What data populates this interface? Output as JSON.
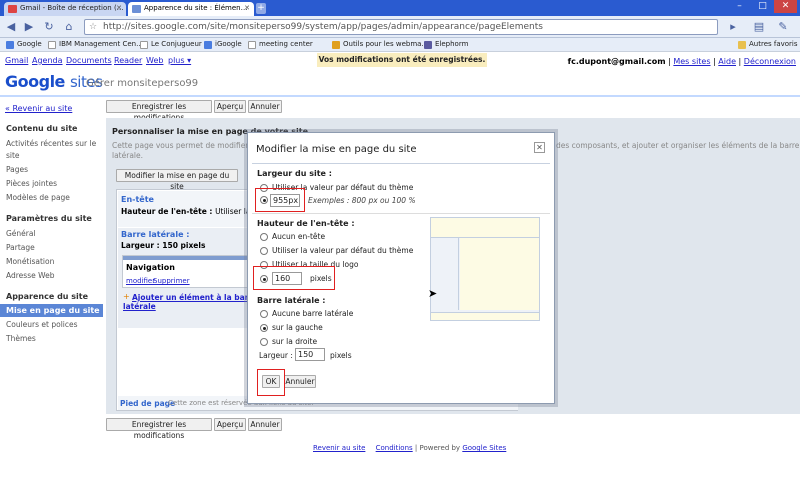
{
  "browser": {
    "tabs": [
      {
        "label": "Gmail - Boîte de réception (…",
        "favicon": "gmail-icon"
      },
      {
        "label": "Apparence du site : Élémen…",
        "favicon": "sites-icon"
      }
    ],
    "url": "http://sites.google.com/site/monsiteperso99/system/app/pages/admin/appearance/pageElements",
    "bookmarks": [
      "Google",
      "IBM Management Cen…",
      "Le Conjugueur",
      "iGoogle",
      "meeting center",
      "Outils pour les webma…",
      "Elephorm"
    ],
    "other_bookmarks": "Autres favoris"
  },
  "gbar": {
    "links": [
      "Gmail",
      "Agenda",
      "Documents",
      "Reader",
      "Web",
      "plus ▾"
    ],
    "saved_message": "Vos modifications ont été enregistrées.",
    "user_email": "fc.dupont@gmail.com",
    "user_links": [
      "Mes sites",
      "Aide",
      "Déconnexion"
    ]
  },
  "header": {
    "logo_google": "Google",
    "logo_sites": "sites",
    "manage_label": "Gérer monsiteperso99"
  },
  "toolbar": {
    "save_label": "Enregistrer les modifications",
    "preview_label": "Aperçu",
    "cancel_label": "Annuler"
  },
  "sidebar": {
    "back_link": "« Revenir au site",
    "sections": [
      {
        "title": "Contenu du site",
        "items": [
          "Activités récentes sur le",
          "site",
          "Pages",
          "Pièces jointes",
          "Modèles de page"
        ]
      },
      {
        "title": "Paramètres du site",
        "items": [
          "Général",
          "Partage",
          "Monétisation",
          "Adresse Web"
        ]
      },
      {
        "title": "Apparence du site",
        "items": [
          "Mise en page du site",
          "Couleurs et polices",
          "Thèmes"
        ]
      }
    ],
    "selected": "Mise en page du site"
  },
  "panel": {
    "title": "Personnaliser la mise en page de votre site",
    "desc_line1": "Cette page vous permet de modifier la",
    "desc_line1_right": "des composants, et ajouter et organiser les éléments de la barre",
    "desc_line2": "latérale.",
    "modify_btn": "Modifier la mise en page du site",
    "header_section": "En-tête",
    "header_height_label": "Hauteur de l'en-tête :",
    "header_height_value": "Utiliser la",
    "sidebar_section": "Barre latérale :",
    "sidebar_width": "Largeur : 150 pixels",
    "nav_title": "Navigation",
    "nav_modify": "modifier",
    "nav_delete": "Supprimer",
    "add_element_1": "Ajouter un élément à la barre",
    "add_element_2": "latérale",
    "footer_label": "Pied de page",
    "footer_text": "Cette zone est réservée aux liens du site."
  },
  "dialog": {
    "title": "Modifier la mise en page du site",
    "site_width_heading": "Largeur du site :",
    "opt_theme_default": "Utiliser la valeur par défaut du thème",
    "width_value": "955px",
    "width_examples": "Exemples : 800 px ou 100 %",
    "header_height_heading": "Hauteur de l'en-tête :",
    "opt_no_header": "Aucun en-tête",
    "opt_header_theme": "Utiliser la valeur par défaut du thème",
    "opt_logo_size": "Utiliser la taille du logo",
    "header_height_value": "160",
    "pixels": "pixels",
    "sidebar_heading": "Barre latérale :",
    "opt_no_sidebar": "Aucune barre latérale",
    "opt_left": "sur la gauche",
    "opt_right": "sur la droite",
    "width_label": "Largeur :",
    "sidebar_width_value": "150",
    "ok_label": "OK",
    "cancel_label": "Annuler"
  },
  "footer": {
    "back": "Revenir au site",
    "conditions": "Conditions",
    "powered": "| Powered by",
    "powered_link": "Google Sites"
  },
  "colors": {
    "link": "#2222cc",
    "selected_nav": "#5b86d6",
    "highlight_box": "#e02020",
    "saved_bg": "#f9edbe"
  }
}
